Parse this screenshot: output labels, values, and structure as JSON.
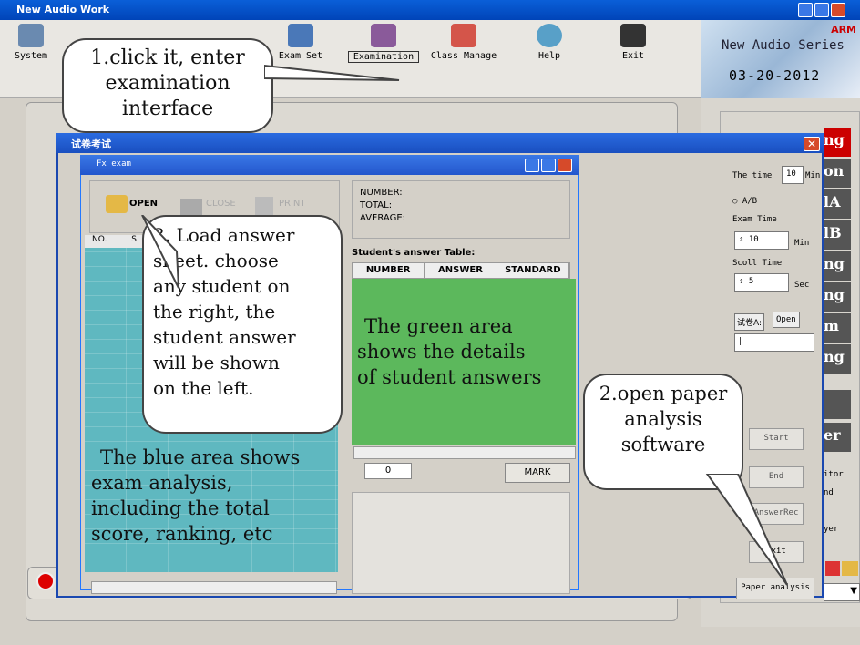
{
  "window": {
    "title": "New Audio Work"
  },
  "toolbar": {
    "items": [
      {
        "label": "System"
      },
      {
        "label": "Exam Set"
      },
      {
        "label": "Examination"
      },
      {
        "label": "Class Manage"
      },
      {
        "label": "Help"
      },
      {
        "label": "Exit"
      }
    ]
  },
  "brand": {
    "logo": "ARM",
    "name": "New Audio Series",
    "date": "03-20-2012"
  },
  "exam_window": {
    "title": "试卷考试"
  },
  "fx": {
    "title": "Fx exam",
    "open_label": "OPEN",
    "close_label": "CLOSE",
    "print_label": "PRINT",
    "col_no": "NO.",
    "col_s": "S",
    "stats": {
      "number": "NUMBER:",
      "total": "TOTAL:",
      "average": "AVERAGE:"
    },
    "answer_table_label": "Student's answer Table:",
    "answer_headers": [
      "NUMBER",
      "ANSWER",
      "STANDARD"
    ],
    "count_value": "0",
    "mark_label": "MARK"
  },
  "right_panel": {
    "time_label": "The time",
    "time_value": "10",
    "time_unit": "Min",
    "ab_label": "A/B",
    "exam_time_label": "Exam Time",
    "exam_time_value": "10",
    "exam_time_unit": "Min",
    "scoll_label": "Scoll Time",
    "scoll_value": "5",
    "scoll_unit": "Sec",
    "paper_a_label": "试卷A:",
    "open_btn": "Open",
    "start_btn": "Start",
    "end_btn": "End",
    "answer_rec_btn": "AnswerRec",
    "exit_btn": "Exit",
    "paper_analysis_btn": "Paper analysis",
    "side_tabs": [
      "ng",
      "on",
      "lA",
      "lB",
      "ng",
      "ng",
      "m",
      "ng",
      "",
      "er"
    ],
    "side_text": [
      "itor",
      "nd",
      "yer"
    ]
  },
  "callouts": {
    "c1": [
      "1.click it, enter",
      "examination",
      "interface"
    ],
    "c2": [
      "2.open paper",
      "analysis",
      "software"
    ],
    "c3": [
      "3. Load answer",
      "sheet. choose",
      "any student on",
      "the right, the",
      "student answer",
      "will be shown",
      "on the left."
    ]
  },
  "overlays": {
    "green": [
      "The green area",
      "shows the details",
      "of student answers"
    ],
    "blue": [
      "The blue area shows",
      "exam analysis,",
      "including the total",
      "score, ranking, etc"
    ]
  }
}
